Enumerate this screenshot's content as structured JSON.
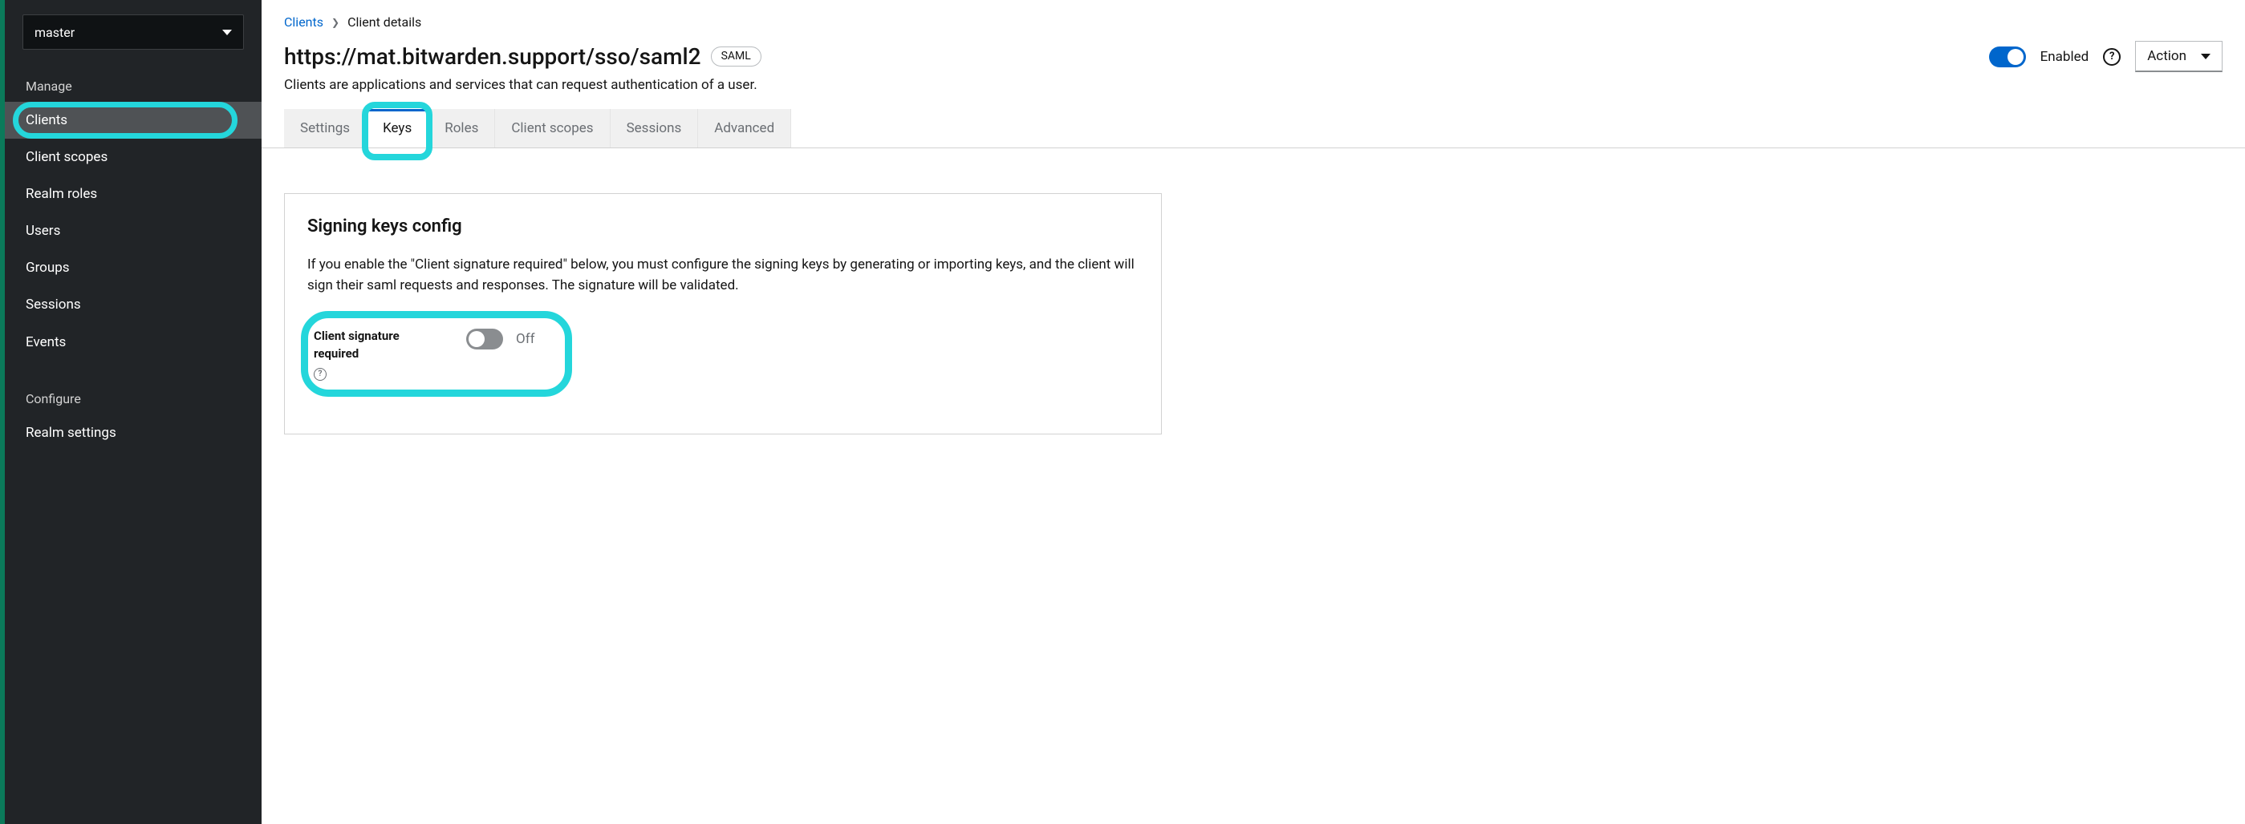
{
  "sidebar": {
    "realm_selected": "master",
    "sections": [
      {
        "label": "Manage",
        "items": [
          {
            "label": "Clients",
            "active": true
          },
          {
            "label": "Client scopes"
          },
          {
            "label": "Realm roles"
          },
          {
            "label": "Users"
          },
          {
            "label": "Groups"
          },
          {
            "label": "Sessions"
          },
          {
            "label": "Events"
          }
        ]
      },
      {
        "label": "Configure",
        "items": [
          {
            "label": "Realm settings"
          }
        ]
      }
    ]
  },
  "breadcrumb": {
    "root": "Clients",
    "current": "Client details"
  },
  "header": {
    "title": "https://mat.bitwarden.support/sso/saml2",
    "protocol_badge": "SAML",
    "subtitle": "Clients are applications and services that can request authentication of a user.",
    "enabled_label": "Enabled",
    "action_label": "Action"
  },
  "tabs": [
    {
      "label": "Settings"
    },
    {
      "label": "Keys",
      "active": true
    },
    {
      "label": "Roles"
    },
    {
      "label": "Client scopes"
    },
    {
      "label": "Sessions"
    },
    {
      "label": "Advanced"
    }
  ],
  "card": {
    "heading": "Signing keys config",
    "description": "If you enable the \"Client signature required\" below, you must configure the signing keys by generating or importing keys, and the client will sign their saml requests and responses. The signature will be validated.",
    "field_label": "Client signature required",
    "switch_state_label": "Off"
  }
}
